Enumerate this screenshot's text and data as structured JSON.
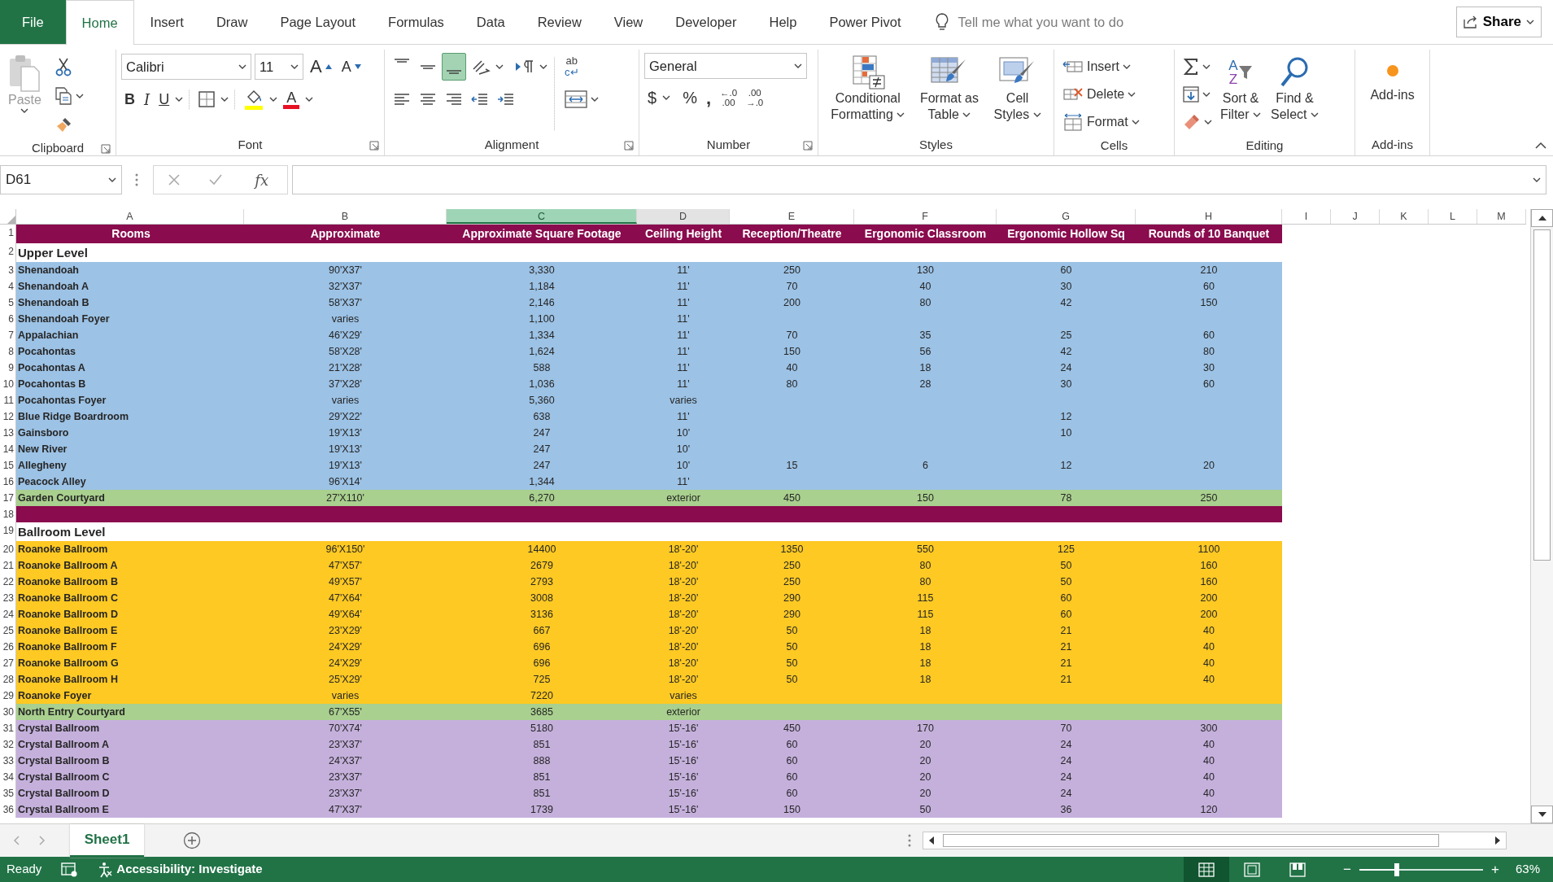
{
  "tabs": [
    {
      "label": "File",
      "kind": "file",
      "selected": false
    },
    {
      "label": "Home",
      "kind": "tab",
      "selected": true
    },
    {
      "label": "Insert",
      "kind": "tab",
      "selected": false
    },
    {
      "label": "Draw",
      "kind": "tab",
      "selected": false
    },
    {
      "label": "Page Layout",
      "kind": "tab",
      "selected": false
    },
    {
      "label": "Formulas",
      "kind": "tab",
      "selected": false
    },
    {
      "label": "Data",
      "kind": "tab",
      "selected": false
    },
    {
      "label": "Review",
      "kind": "tab",
      "selected": false
    },
    {
      "label": "View",
      "kind": "tab",
      "selected": false
    },
    {
      "label": "Developer",
      "kind": "tab",
      "selected": false
    },
    {
      "label": "Help",
      "kind": "tab",
      "selected": false
    },
    {
      "label": "Power Pivot",
      "kind": "tab",
      "selected": false
    }
  ],
  "tell_me": {
    "placeholder": "Tell me what you want to do"
  },
  "share": "Share",
  "ribbon": {
    "clipboard": {
      "label": "Clipboard",
      "paste": {
        "label": "Paste",
        "disabled": true
      }
    },
    "font": {
      "label": "Font",
      "font_name": "Calibri",
      "font_size": "11",
      "grow": "A",
      "shrink": "A",
      "bold": "B",
      "italic": "I",
      "underline": "U",
      "font_color": "A"
    },
    "alignment": {
      "label": "Alignment",
      "vertical_align": [
        {
          "selected": false
        },
        {
          "selected": false
        },
        {
          "selected": true
        }
      ],
      "wrap_text": [
        "ab",
        "c↵"
      ]
    },
    "number": {
      "label": "Number",
      "format": "General",
      "currency": "$",
      "percent": "%",
      "comma": ",",
      "increase_decimal": [
        "←.0",
        ".00"
      ],
      "decrease_decimal": [
        ".00",
        "→.0"
      ]
    },
    "styles": {
      "label": "Styles",
      "buttons": [
        {
          "lines": [
            "Conditional",
            "Formatting"
          ]
        },
        {
          "lines": [
            "Format as",
            "Table"
          ]
        },
        {
          "lines": [
            "Cell",
            "Styles"
          ]
        }
      ]
    },
    "cells": {
      "label": "Cells",
      "buttons": [
        "Insert",
        "Delete",
        "Format"
      ]
    },
    "editing": {
      "label": "Editing",
      "sort_letters": [
        "A",
        "Z"
      ],
      "buttons": [
        {
          "lines": [
            "Sort &",
            "Filter"
          ]
        },
        {
          "lines": [
            "Find &",
            "Select"
          ]
        }
      ]
    },
    "add_ins": {
      "label": "Add-ins",
      "button": "Add-ins"
    }
  },
  "formula_bar": {
    "name_box": "D61",
    "function_button": "fx"
  },
  "sheet": {
    "columns": [
      {
        "label": "A",
        "selected": false,
        "hovered": false
      },
      {
        "label": "B",
        "selected": false,
        "hovered": false
      },
      {
        "label": "C",
        "selected": true,
        "hovered": false
      },
      {
        "label": "D",
        "selected": false,
        "hovered": true
      },
      {
        "label": "E",
        "selected": false,
        "hovered": false
      },
      {
        "label": "F",
        "selected": false,
        "hovered": false
      },
      {
        "label": "G",
        "selected": false,
        "hovered": false
      },
      {
        "label": "H",
        "selected": false,
        "hovered": false
      },
      {
        "label": "I",
        "selected": false,
        "hovered": false
      },
      {
        "label": "J",
        "selected": false,
        "hovered": false
      },
      {
        "label": "K",
        "selected": false,
        "hovered": false
      },
      {
        "label": "L",
        "selected": false,
        "hovered": false
      },
      {
        "label": "M",
        "selected": false,
        "hovered": false
      }
    ],
    "rows": [
      {
        "row_number": "1",
        "kind": "header",
        "color": "#8a0b4e",
        "cells": {
          "A": "Rooms",
          "B": "Approximate",
          "C": "Approximate Square Footage",
          "D": "Ceiling Height",
          "E": "Reception/Theatre",
          "F": "Ergonomic Classroom",
          "G": "Ergonomic Hollow Sq",
          "H": "Rounds of 10 Banquet"
        }
      },
      {
        "row_number": "2",
        "kind": "section",
        "cells": {
          "A": "Upper Level"
        }
      },
      {
        "row_number": "3",
        "kind": "data",
        "color": "#9cc2e5",
        "cells": {
          "A": "Shenandoah",
          "B": "90'X37'",
          "C": "3,330",
          "D": "11'",
          "E": "250",
          "F": "130",
          "G": "60",
          "H": "210"
        }
      },
      {
        "row_number": "4",
        "kind": "data",
        "color": "#9cc2e5",
        "cells": {
          "A": "Shenandoah A",
          "B": "32'X37'",
          "C": "1,184",
          "D": "11'",
          "E": "70",
          "F": "40",
          "G": "30",
          "H": "60"
        }
      },
      {
        "row_number": "5",
        "kind": "data",
        "color": "#9cc2e5",
        "cells": {
          "A": "Shenandoah B",
          "B": "58'X37'",
          "C": "2,146",
          "D": "11'",
          "E": "200",
          "F": "80",
          "G": "42",
          "H": "150"
        }
      },
      {
        "row_number": "6",
        "kind": "data",
        "color": "#9cc2e5",
        "cells": {
          "A": "Shenandoah Foyer",
          "B": "varies",
          "C": "1,100",
          "D": "11'"
        }
      },
      {
        "row_number": "7",
        "kind": "data",
        "color": "#9cc2e5",
        "cells": {
          "A": "Appalachian",
          "B": "46'X29'",
          "C": "1,334",
          "D": "11'",
          "E": "70",
          "F": "35",
          "G": "25",
          "H": "60"
        }
      },
      {
        "row_number": "8",
        "kind": "data",
        "color": "#9cc2e5",
        "cells": {
          "A": "Pocahontas",
          "B": "58'X28'",
          "C": "1,624",
          "D": "11'",
          "E": "150",
          "F": "56",
          "G": "42",
          "H": "80"
        }
      },
      {
        "row_number": "9",
        "kind": "data",
        "color": "#9cc2e5",
        "cells": {
          "A": "Pocahontas A",
          "B": "21'X28'",
          "C": "588",
          "D": "11'",
          "E": "40",
          "F": "18",
          "G": "24",
          "H": "30"
        }
      },
      {
        "row_number": "10",
        "kind": "data",
        "color": "#9cc2e5",
        "cells": {
          "A": "Pocahontas B",
          "B": "37'X28'",
          "C": "1,036",
          "D": "11'",
          "E": "80",
          "F": "28",
          "G": "30",
          "H": "60"
        }
      },
      {
        "row_number": "11",
        "kind": "data",
        "color": "#9cc2e5",
        "cells": {
          "A": "Pocahontas Foyer",
          "B": "varies",
          "C": "5,360",
          "D": "varies"
        }
      },
      {
        "row_number": "12",
        "kind": "data",
        "color": "#9cc2e5",
        "cells": {
          "A": "Blue Ridge Boardroom",
          "B": "29'X22'",
          "C": "638",
          "D": "11'",
          "G": "12"
        }
      },
      {
        "row_number": "13",
        "kind": "data",
        "color": "#9cc2e5",
        "cells": {
          "A": "Gainsboro",
          "B": "19'X13'",
          "C": "247",
          "D": "10'",
          "G": "10"
        }
      },
      {
        "row_number": "14",
        "kind": "data",
        "color": "#9cc2e5",
        "cells": {
          "A": "New River",
          "B": "19'X13'",
          "C": "247",
          "D": "10'"
        }
      },
      {
        "row_number": "15",
        "kind": "data",
        "color": "#9cc2e5",
        "cells": {
          "A": "Allegheny",
          "B": "19'X13'",
          "C": "247",
          "D": "10'",
          "E": "15",
          "F": "6",
          "G": "12",
          "H": "20"
        }
      },
      {
        "row_number": "16",
        "kind": "data",
        "color": "#9cc2e5",
        "cells": {
          "A": "Peacock Alley",
          "B": "96'X14'",
          "C": "1,344",
          "D": "11'"
        }
      },
      {
        "row_number": "17",
        "kind": "data",
        "color": "#a9d08e",
        "cells": {
          "A": "Garden Courtyard",
          "B": "27'X110'",
          "C": "6,270",
          "D": "exterior",
          "E": "450",
          "F": "150",
          "G": "78",
          "H": "250"
        }
      },
      {
        "row_number": "18",
        "kind": "divider",
        "color": "#8a0b4e"
      },
      {
        "row_number": "19",
        "kind": "section",
        "cells": {
          "A": "Ballroom Level"
        }
      },
      {
        "row_number": "20",
        "kind": "data",
        "color": "#fec923",
        "cells": {
          "A": "Roanoke Ballroom",
          "B": "96'X150'",
          "C": "14400",
          "D": "18'-20'",
          "E": "1350",
          "F": "550",
          "G": "125",
          "H": "1100"
        }
      },
      {
        "row_number": "21",
        "kind": "data",
        "color": "#fec923",
        "cells": {
          "A": "Roanoke Ballroom A",
          "B": "47'X57'",
          "C": "2679",
          "D": "18'-20'",
          "E": "250",
          "F": "80",
          "G": "50",
          "H": "160"
        }
      },
      {
        "row_number": "22",
        "kind": "data",
        "color": "#fec923",
        "cells": {
          "A": "Roanoke Ballroom B",
          "B": "49'X57'",
          "C": "2793",
          "D": "18'-20'",
          "E": "250",
          "F": "80",
          "G": "50",
          "H": "160"
        }
      },
      {
        "row_number": "23",
        "kind": "data",
        "color": "#fec923",
        "cells": {
          "A": "Roanoke Ballroom C",
          "B": "47'X64'",
          "C": "3008",
          "D": "18'-20'",
          "E": "290",
          "F": "115",
          "G": "60",
          "H": "200"
        }
      },
      {
        "row_number": "24",
        "kind": "data",
        "color": "#fec923",
        "cells": {
          "A": "Roanoke Ballroom D",
          "B": "49'X64'",
          "C": "3136",
          "D": "18'-20'",
          "E": "290",
          "F": "115",
          "G": "60",
          "H": "200"
        }
      },
      {
        "row_number": "25",
        "kind": "data",
        "color": "#fec923",
        "cells": {
          "A": "Roanoke Ballroom E",
          "B": "23'X29'",
          "C": "667",
          "D": "18'-20'",
          "E": "50",
          "F": "18",
          "G": "21",
          "H": "40"
        }
      },
      {
        "row_number": "26",
        "kind": "data",
        "color": "#fec923",
        "cells": {
          "A": "Roanoke Ballroom F",
          "B": "24'X29'",
          "C": "696",
          "D": "18'-20'",
          "E": "50",
          "F": "18",
          "G": "21",
          "H": "40"
        }
      },
      {
        "row_number": "27",
        "kind": "data",
        "color": "#fec923",
        "cells": {
          "A": "Roanoke Ballroom G",
          "B": "24'X29'",
          "C": "696",
          "D": "18'-20'",
          "E": "50",
          "F": "18",
          "G": "21",
          "H": "40"
        }
      },
      {
        "row_number": "28",
        "kind": "data",
        "color": "#fec923",
        "cells": {
          "A": "Roanoke Ballroom H",
          "B": "25'X29'",
          "C": "725",
          "D": "18'-20'",
          "E": "50",
          "F": "18",
          "G": "21",
          "H": "40"
        }
      },
      {
        "row_number": "29",
        "kind": "data",
        "color": "#fec923",
        "cells": {
          "A": "Roanoke Foyer",
          "B": "varies",
          "C": "7220",
          "D": "varies"
        }
      },
      {
        "row_number": "30",
        "kind": "data",
        "color": "#a9d08e",
        "cells": {
          "A": "North Entry Courtyard",
          "B": "67'X55'",
          "C": "3685",
          "D": "exterior"
        }
      },
      {
        "row_number": "31",
        "kind": "data",
        "color": "#c5b0dc",
        "cells": {
          "A": "Crystal Ballroom",
          "B": "70'X74'",
          "C": "5180",
          "D": "15'-16'",
          "E": "450",
          "F": "170",
          "G": "70",
          "H": "300"
        }
      },
      {
        "row_number": "32",
        "kind": "data",
        "color": "#c5b0dc",
        "cells": {
          "A": "Crystal Ballroom A",
          "B": "23'X37'",
          "C": "851",
          "D": "15'-16'",
          "E": "60",
          "F": "20",
          "G": "24",
          "H": "40"
        }
      },
      {
        "row_number": "33",
        "kind": "data",
        "color": "#c5b0dc",
        "cells": {
          "A": "Crystal Ballroom B",
          "B": "24'X37'",
          "C": "888",
          "D": "15'-16'",
          "E": "60",
          "F": "20",
          "G": "24",
          "H": "40"
        }
      },
      {
        "row_number": "34",
        "kind": "data",
        "color": "#c5b0dc",
        "cells": {
          "A": "Crystal Ballroom C",
          "B": "23'X37'",
          "C": "851",
          "D": "15'-16'",
          "E": "60",
          "F": "20",
          "G": "24",
          "H": "40"
        }
      },
      {
        "row_number": "35",
        "kind": "data",
        "color": "#c5b0dc",
        "cells": {
          "A": "Crystal Ballroom D",
          "B": "23'X37'",
          "C": "851",
          "D": "15'-16'",
          "E": "60",
          "F": "20",
          "G": "24",
          "H": "40"
        }
      },
      {
        "row_number": "36",
        "kind": "data",
        "color": "#c5b0dc",
        "cells": {
          "A": "Crystal Ballroom E",
          "B": "47'X37'",
          "C": "1739",
          "D": "15'-16'",
          "E": "150",
          "F": "50",
          "G": "36",
          "H": "120"
        }
      }
    ]
  },
  "sheet_tabs": [
    {
      "label": "Sheet1",
      "selected": true
    }
  ],
  "status_bar": {
    "status": "Ready",
    "accessibility": "Accessibility: Investigate",
    "views": [
      {
        "selected": true
      },
      {
        "selected": false
      },
      {
        "selected": false
      }
    ],
    "zoom_out": "−",
    "zoom_slider": {
      "level": 0.3
    },
    "zoom_in": "+",
    "zoom": "63%"
  }
}
